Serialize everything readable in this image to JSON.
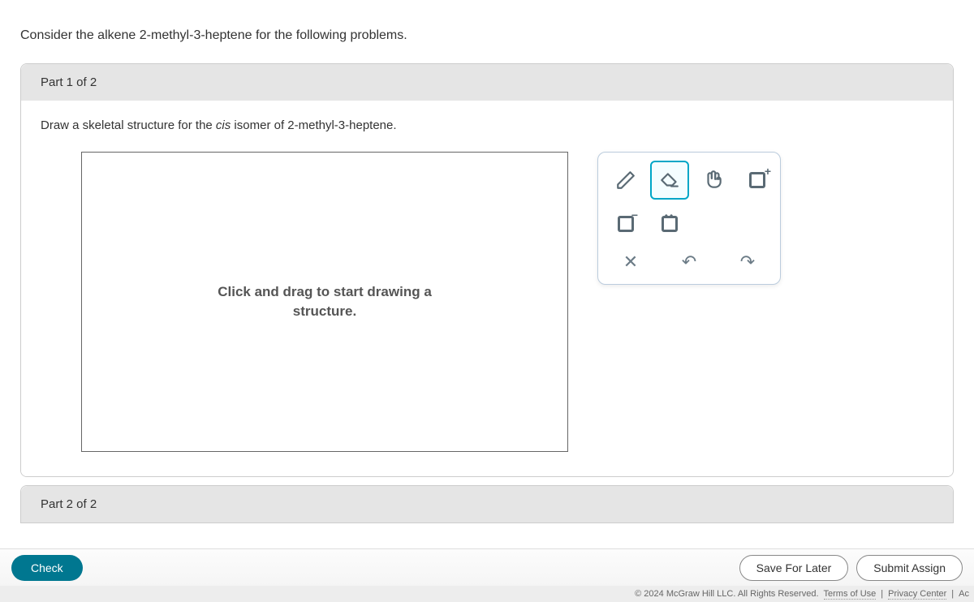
{
  "prompt": "Consider the alkene 2-methyl-3-heptene for the following problems.",
  "part1": {
    "header": "Part 1 of 2",
    "instruction_a": "Draw a skeletal structure for the ",
    "instruction_italic": "cis",
    "instruction_b": " isomer of 2-methyl-3-heptene.",
    "draw_hint_a": "Click and drag to start drawing a",
    "draw_hint_b": "structure."
  },
  "tools": {
    "pencil": "pencil-icon",
    "eraser": "eraser-icon",
    "hand": "hand-icon",
    "square_plus": "square-plus-icon",
    "square_minus": "square-minus-icon",
    "square_dots": "square-dots-icon",
    "clear": "✕",
    "undo": "↶",
    "redo": "↷"
  },
  "part2": {
    "header": "Part 2 of 2"
  },
  "buttons": {
    "check": "Check",
    "save": "Save For Later",
    "submit": "Submit Assign"
  },
  "footer": {
    "copyright": "© 2024 McGraw Hill LLC. All Rights Reserved.",
    "terms": "Terms of Use",
    "privacy": "Privacy Center",
    "acc": "Ac"
  }
}
